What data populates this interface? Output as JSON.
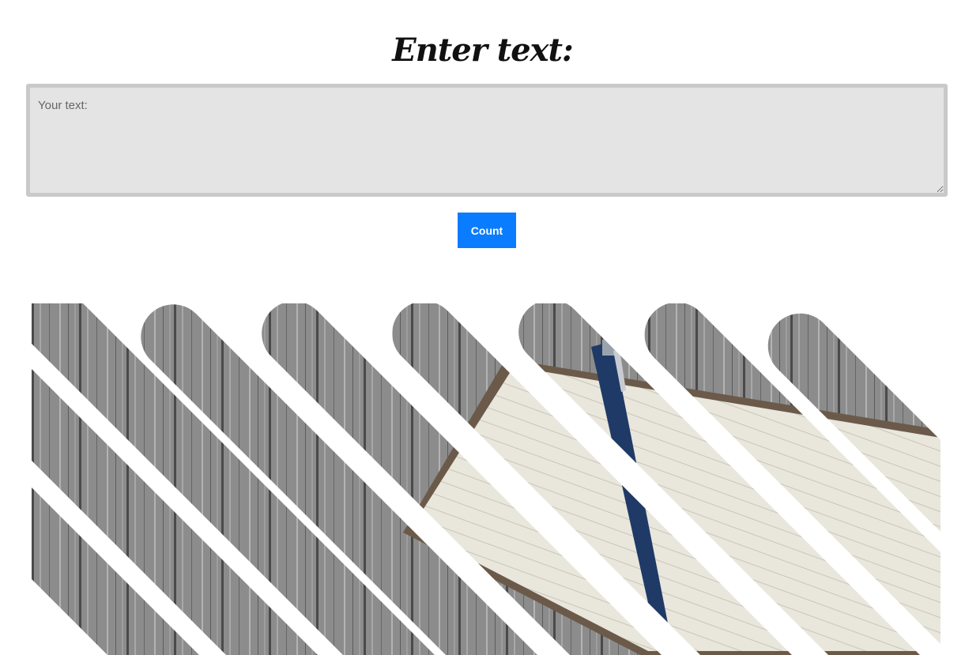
{
  "heading": "Enter text:",
  "input": {
    "placeholder": "Your text:",
    "value": ""
  },
  "button": {
    "label": "Count"
  },
  "hero_image": {
    "description_icon": "notebook-pen-image",
    "accent_colors": {
      "button": "#0a7cff",
      "textarea_bg": "#e4e4e4",
      "textarea_border": "#c9c9c9"
    }
  }
}
